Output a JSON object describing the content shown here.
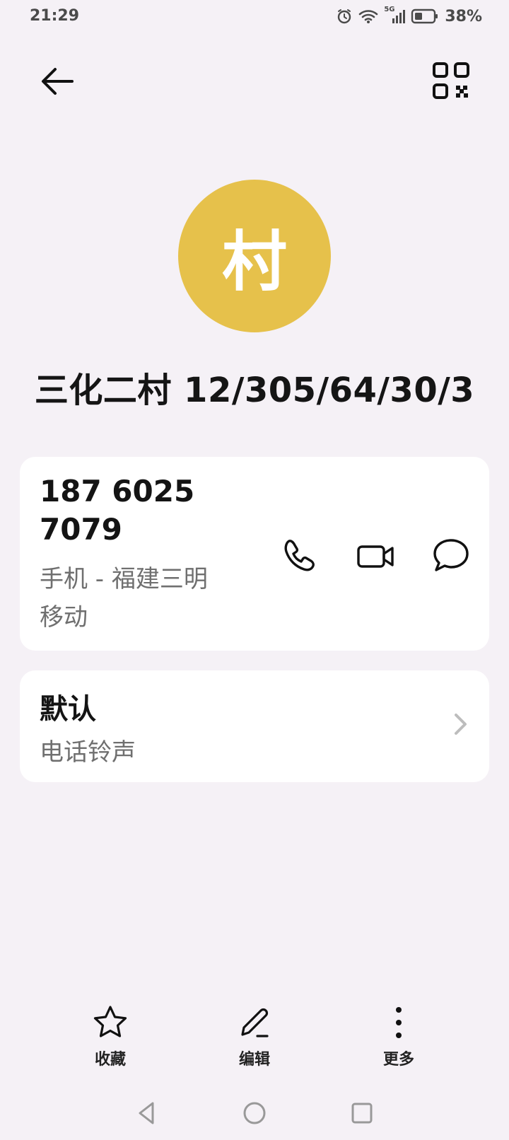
{
  "status": {
    "time": "21:29",
    "network": "5G",
    "battery": "38%"
  },
  "icons": {
    "back": "arrow-left-icon",
    "qr": "qr-code-icon",
    "call": "phone-icon",
    "video": "video-camera-icon",
    "message": "chat-bubble-icon",
    "chevron": "chevron-right-icon",
    "favorite": "star-icon",
    "edit": "pencil-icon",
    "more": "more-vertical-icon"
  },
  "contact": {
    "avatar_text": "村",
    "name": "三化二村 12/305/64/30/3",
    "avatar_color": "#e6c14b"
  },
  "phone": {
    "number_line1": "187 6025",
    "number_line2": "7079",
    "meta_line1": "手机 - 福建三明",
    "meta_line2": "移动"
  },
  "ringtone": {
    "title": "默认",
    "subtitle": "电话铃声"
  },
  "bottom_actions": {
    "favorite": "收藏",
    "edit": "编辑",
    "more": "更多"
  }
}
